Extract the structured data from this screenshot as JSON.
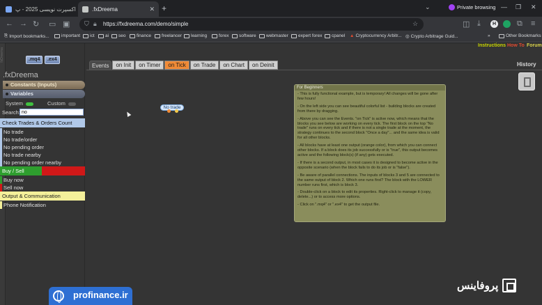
{
  "browser": {
    "tabs": [
      {
        "title": "آموزش اکسپرت نویسی 2025 - پ...",
        "active": false,
        "favicon_color": "#7aa7f5"
      },
      {
        "title": ".fxDreema",
        "active": true,
        "favicon_color": "#c4c7c5"
      }
    ],
    "private_label": "Private browsing",
    "url": "https://fxdreema.com/demo/simple",
    "bookmarks": [
      "Import bookmarks...",
      "important",
      "ict",
      "ai",
      "seo",
      "finance",
      "freelancer",
      "learning",
      "forex",
      "software",
      "webmaster",
      "expert forex",
      "cpanel",
      "Cryptocurrency Arbitr...",
      "Crypto Arbitrage Guid...",
      "Other Bookmarks"
    ]
  },
  "app": {
    "vertical_label": "fxDreema",
    "export_buttons": [
      ".mq4",
      ".ex4"
    ],
    "brand": ".fxDreema",
    "top_links": {
      "instructions": "Instructions",
      "howto": "How To",
      "forum": "Forum"
    },
    "sections": {
      "constants": "Constants (Inputs)",
      "variables": "Variables"
    },
    "toggles": {
      "system": "System",
      "custom": "Custom"
    },
    "search": {
      "label": "Search:",
      "value": "no"
    },
    "categories": [
      {
        "title": "Check Trades & Orders Count",
        "items": [
          "No trade",
          "No trade/order",
          "No pending order",
          "No trade nearby",
          "No pending order nearby"
        ]
      },
      {
        "title": "Buy / Sell",
        "items": [
          "Buy now",
          "Sell now"
        ]
      },
      {
        "title": "Output & Communication",
        "items": [
          "Phone Notification"
        ]
      }
    ],
    "events_label": "Events",
    "events": [
      "on Init",
      "on Timer",
      "on Tick",
      "on Trade",
      "on Chart",
      "on Deinit"
    ],
    "active_event": "on Tick",
    "history_label": "History",
    "block_label": "No trade",
    "note": {
      "title": "For Beginners",
      "paragraphs": [
        "- This is fully functional example, but is temporary! All changes will be gone after few hours!",
        "- On the left side you can see beautiful colorful list - building blocks are created from there by dragging.",
        "- Above you can see the Events. \"on Tick\" is active now, which means that the blocks you see below are working on every tick. The first block on the top \"No trade\" runs on every tick and if there is not a single trade at the moment, the strategy continues to the second block \"Once a day\"... and the same idea is valid for all other blocks.",
        "- All blocks have at least one output (orange color), from which you can connect other blocks. If a block does its job successfully or is \"true\", this output becomes active and the following block(s) (if any) gets executed.",
        "- If there is a second output, in most cases it is designed to become active in the opposite scenario (when the block fails to do its job or is \"false\").",
        "- Be aware of parallel connections. The inputs of blocks 3 and 5 are connected to the same output of block 2. Which one runs first? The block with the LOWER number runs first, which is block 3.",
        "- Double-click on a block to edit its properties. Right-click to manage it (copy, delete...) or to access more options.",
        "- Click on \".mq4\" or \".ex4\" to get the output file."
      ]
    }
  },
  "overlay": {
    "site_banner": "profinance.ir",
    "watermark": "پروفاینس"
  }
}
